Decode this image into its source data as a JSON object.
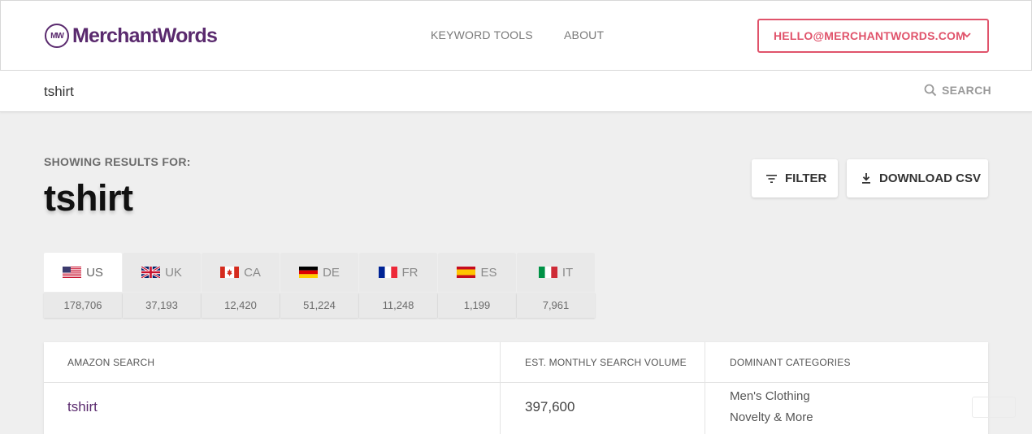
{
  "header": {
    "logo_text": "MerchantWords",
    "logo_mark": "MW",
    "nav": [
      {
        "label": "KEYWORD TOOLS"
      },
      {
        "label": "ABOUT"
      }
    ],
    "account_email": "HELLO@MERCHANTWORDS.COM"
  },
  "search": {
    "value": "tshirt",
    "button_label": "SEARCH"
  },
  "results": {
    "showing_label": "SHOWING RESULTS FOR:",
    "query": "tshirt",
    "filter_label": "FILTER",
    "download_label": "DOWNLOAD CSV"
  },
  "countries": [
    {
      "code": "US",
      "count": "178,706",
      "active": true
    },
    {
      "code": "UK",
      "count": "37,193"
    },
    {
      "code": "CA",
      "count": "12,420"
    },
    {
      "code": "DE",
      "count": "51,224"
    },
    {
      "code": "FR",
      "count": "11,248"
    },
    {
      "code": "ES",
      "count": "1,199"
    },
    {
      "code": "IT",
      "count": "7,961"
    }
  ],
  "table": {
    "headers": [
      "AMAZON SEARCH",
      "EST. MONTHLY SEARCH VOLUME",
      "DOMINANT CATEGORIES"
    ],
    "rows": [
      {
        "search": "tshirt",
        "volume": "397,600",
        "categories": [
          "Men's Clothing",
          "Novelty & More"
        ]
      }
    ]
  },
  "colors": {
    "brand": "#5a2a6e",
    "accent": "#e0536b"
  }
}
